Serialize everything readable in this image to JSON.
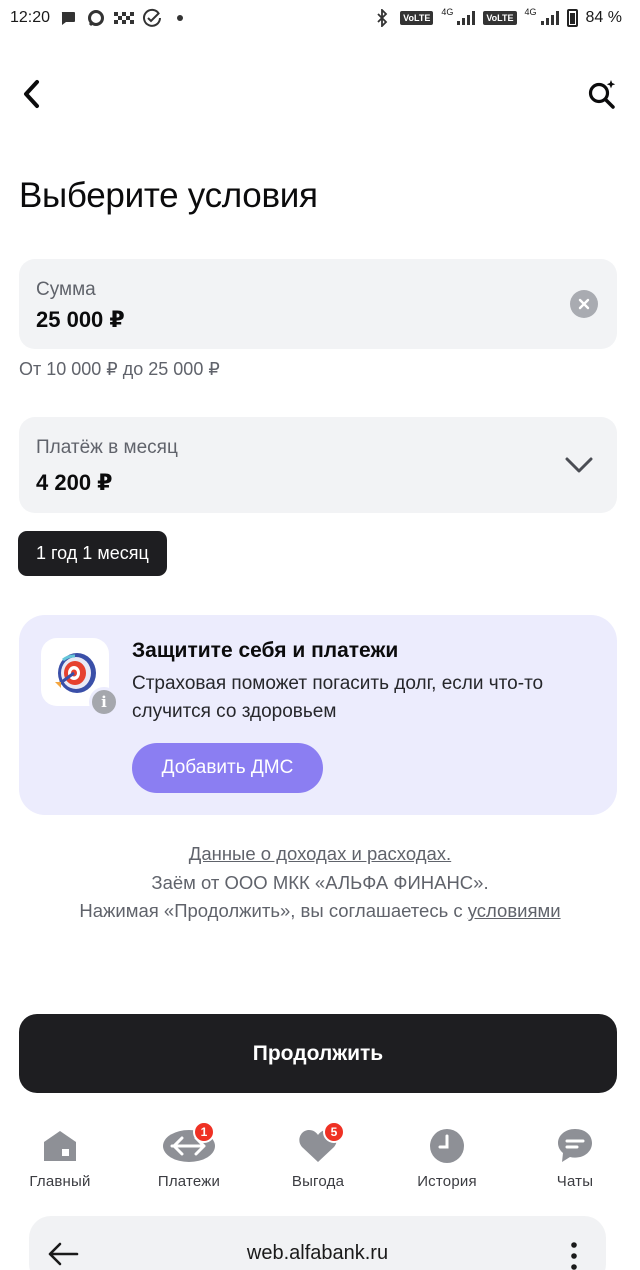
{
  "status_bar": {
    "time": "12:20",
    "battery": "84 %",
    "network_1": "4G",
    "network_2": "4G",
    "volte_1": "VoLTE",
    "volte_2": "VoLTE"
  },
  "header": {
    "title": "Выберите условия"
  },
  "amount_field": {
    "label": "Сумма",
    "value": "25 000 ₽",
    "hint": "От 10 000 ₽ до 25 000 ₽"
  },
  "payment_field": {
    "label": "Платёж в месяц",
    "value": "4 200 ₽"
  },
  "term_chip": {
    "label": "1 год 1 месяц"
  },
  "promo": {
    "title": "Защитите себя и платежи",
    "text": "Страховая поможет погасить долг, если что-то случится со здоровьем",
    "button": "Добавить ДМС",
    "info_icon": "i"
  },
  "legal": {
    "line1_link": "Данные о доходах и расходах.",
    "line2": "Заём от ООО МКК «АЛЬФА ФИНАНС».",
    "line3_text": "Нажимая «Продолжить», вы соглашаетесь с",
    "line3_link": "условиями"
  },
  "continue_button": {
    "label": "Продолжить"
  },
  "tab_bar": {
    "tabs": [
      {
        "label": "Главный",
        "icon": "home-icon"
      },
      {
        "label": "Платежи",
        "icon": "payments-icon",
        "badge": "1"
      },
      {
        "label": "Выгода",
        "icon": "heart-icon",
        "badge": "5"
      },
      {
        "label": "История",
        "icon": "clock-icon"
      },
      {
        "label": "Чаты",
        "icon": "chat-icon"
      }
    ]
  },
  "browser": {
    "url": "web.alfabank.ru"
  },
  "colors": {
    "accent_purple": "#8b7ef2",
    "promo_bg": "#ececfd",
    "dark_button": "#1e1e21",
    "badge_red": "#ef3124",
    "field_bg": "#f2f3f5"
  }
}
